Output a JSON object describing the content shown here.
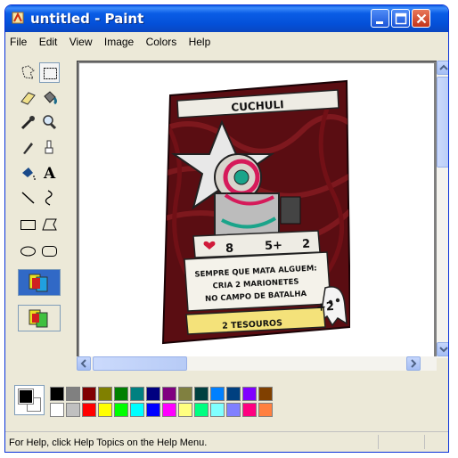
{
  "window": {
    "title": "untitled - Paint"
  },
  "menu": [
    "File",
    "Edit",
    "View",
    "Image",
    "Colors",
    "Help"
  ],
  "tools": [
    {
      "name": "free-form-select-icon"
    },
    {
      "name": "select-icon"
    },
    {
      "name": "eraser-icon"
    },
    {
      "name": "fill-icon"
    },
    {
      "name": "pick-color-icon"
    },
    {
      "name": "magnifier-icon"
    },
    {
      "name": "pencil-icon"
    },
    {
      "name": "brush-icon"
    },
    {
      "name": "airbrush-icon"
    },
    {
      "name": "text-icon"
    },
    {
      "name": "line-icon"
    },
    {
      "name": "curve-icon"
    },
    {
      "name": "rectangle-icon"
    },
    {
      "name": "polygon-icon"
    },
    {
      "name": "ellipse-icon"
    },
    {
      "name": "rounded-rectangle-icon"
    }
  ],
  "palette": {
    "top": [
      "#000000",
      "#808080",
      "#800000",
      "#808000",
      "#008000",
      "#008080",
      "#000080",
      "#800080",
      "#808040",
      "#004040",
      "#0080ff",
      "#004080",
      "#8000ff",
      "#804000"
    ],
    "bottom": [
      "#ffffff",
      "#c0c0c0",
      "#ff0000",
      "#ffff00",
      "#00ff00",
      "#00ffff",
      "#0000ff",
      "#ff00ff",
      "#ffff80",
      "#00ff80",
      "#80ffff",
      "#8080ff",
      "#ff0080",
      "#ff8040"
    ]
  },
  "card": {
    "name": "CUCHULI",
    "stat_attack": "8",
    "stat_dice": "5+",
    "stat_extra": "2",
    "text_line1": "SEMPRE QUE MATA ALGUEM:",
    "text_line2": "CRIA 2 MARIONETES",
    "text_line3": "NO CAMPO DE BATALHA",
    "reward": "2 TESOUROS",
    "bonus": "+2"
  },
  "status": {
    "text": "For Help, click Help Topics on the Help Menu."
  }
}
